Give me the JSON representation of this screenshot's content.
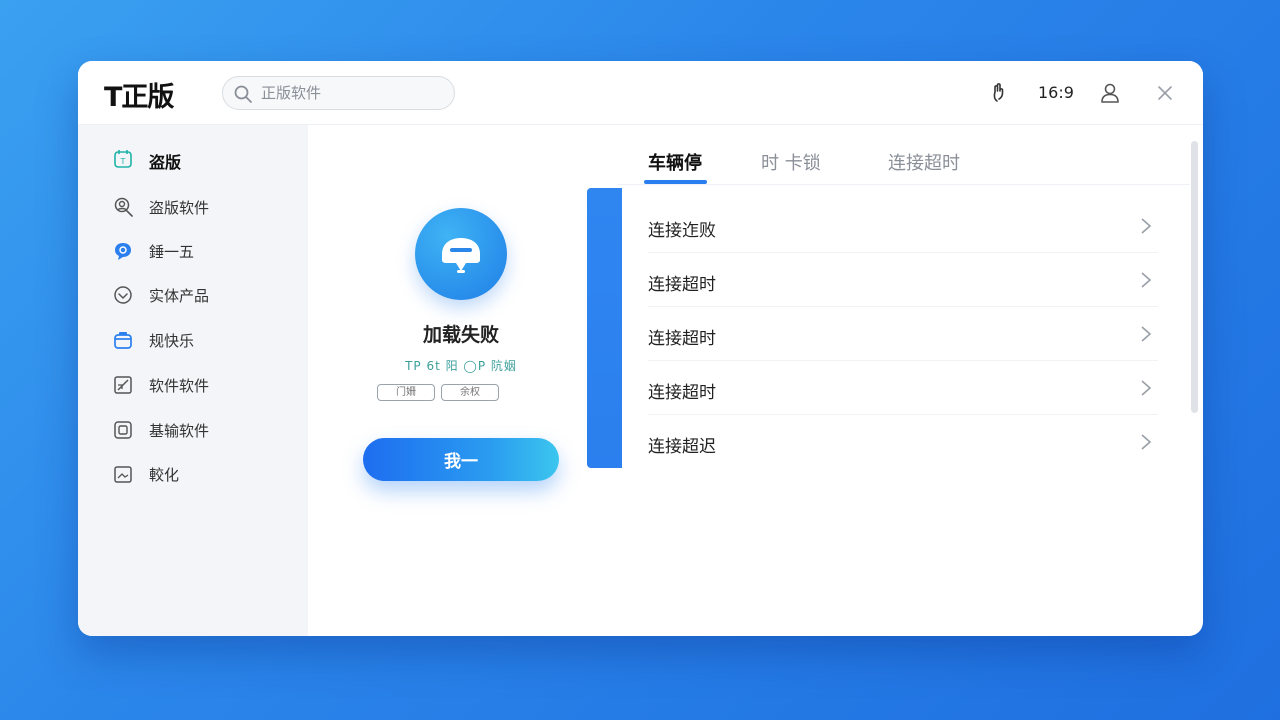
{
  "header": {
    "logo": "T正版",
    "search_placeholder": "正版软件",
    "aspect_ratio": "16:9"
  },
  "sidebar": {
    "items": [
      {
        "label": "盗版",
        "icon": "calendar-t-icon",
        "active": true
      },
      {
        "label": "盗版软件",
        "icon": "user-search-icon"
      },
      {
        "label": "錘一五",
        "icon": "chat-bubble-icon"
      },
      {
        "label": "实体产品",
        "icon": "heart-badge-icon"
      },
      {
        "label": "规快乐",
        "icon": "basket-icon"
      },
      {
        "label": "软件软件",
        "icon": "edit-square-icon"
      },
      {
        "label": "基输软件",
        "icon": "device-icon"
      },
      {
        "label": "較化",
        "icon": "image-icon"
      }
    ]
  },
  "profile": {
    "title": "加载失败",
    "meta": "TP 6t 阳  ◯P 阬姻",
    "tags": [
      "门姍",
      "余权"
    ],
    "button": "我一"
  },
  "tabs": [
    {
      "label": "车辆停",
      "active": true
    },
    {
      "label": "时 卡锁"
    },
    {
      "label": "连接超时"
    }
  ],
  "list": [
    "连接迮败",
    "连接超时",
    "连接超时",
    "连接超时",
    "连接超迟"
  ],
  "colors": {
    "accent": "#2a7ff0",
    "background_gradient_start": "#3aa0f0",
    "background_gradient_end": "#1f6fe0"
  }
}
